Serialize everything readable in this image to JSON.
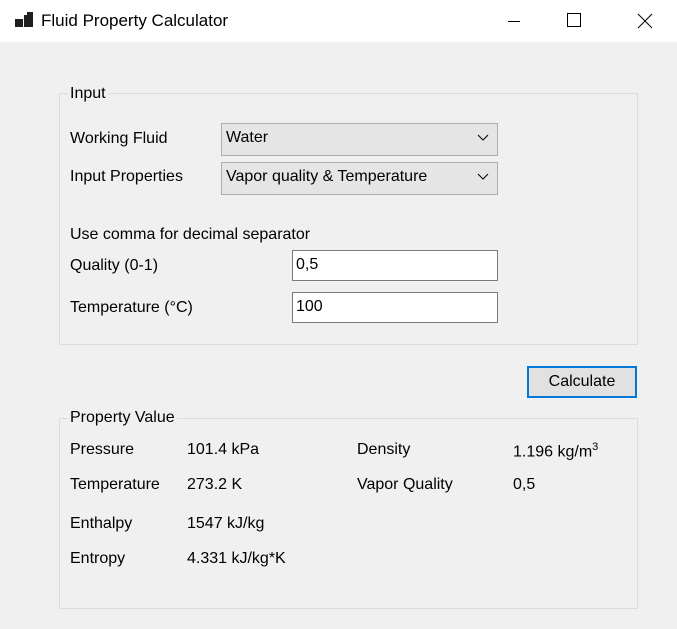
{
  "window": {
    "title": "Fluid Property Calculator"
  },
  "input_group": {
    "legend": "Input",
    "working_fluid_label": "Working Fluid",
    "working_fluid_value": "Water",
    "input_properties_label": "Input Properties",
    "input_properties_value": "Vapor quality & Temperature",
    "hint": "Use comma for decimal separator",
    "quality_label": "Quality (0-1)",
    "quality_value": "0,5",
    "temperature_label": "Temperature (°C)",
    "temperature_value": "100"
  },
  "calculate_button": {
    "label": "Calculate"
  },
  "property_group": {
    "legend": "Property Value",
    "pressure_label": "Pressure",
    "pressure_value": "101.4 kPa",
    "temperature_label": "Temperature",
    "temperature_value": "273.2 K",
    "enthalpy_label": "Enthalpy",
    "enthalpy_value": "1547 kJ/kg",
    "entropy_label": "Entropy",
    "entropy_value": "4.331 kJ/kg*K",
    "density_label": "Density",
    "density_value": "1.196 kg/m",
    "density_exponent": "3",
    "vapor_quality_label": "Vapor Quality",
    "vapor_quality_value": "0,5"
  },
  "icons": {
    "app": "app-icon",
    "minimize": "minimize-icon",
    "maximize": "maximize-icon",
    "close": "close-icon",
    "dropdown": "chevron-down-icon"
  }
}
